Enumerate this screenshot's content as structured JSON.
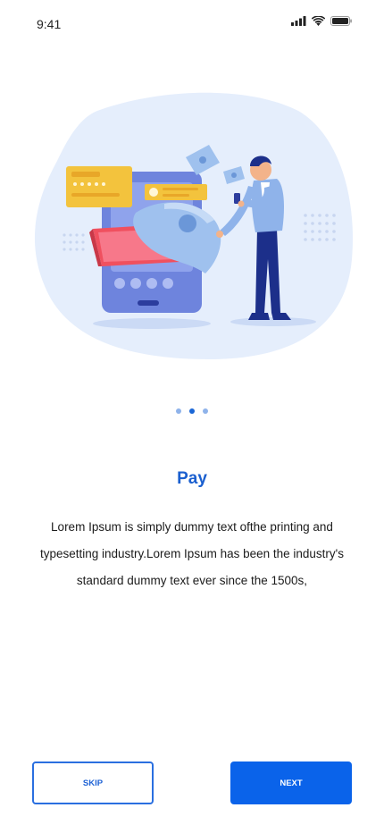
{
  "status_bar": {
    "time": "9:41",
    "icons": [
      "signal-icon",
      "wifi-icon",
      "battery-icon"
    ]
  },
  "onboarding": {
    "page_indicator": {
      "total": 3,
      "active_index": 1
    },
    "title": "Pay",
    "description": "Lorem Ipsum is simply dummy text ofthe printing and typesetting industry.Lorem Ipsum has been the industry's standard dummy text ever since the 1500s,"
  },
  "buttons": {
    "skip": "SKIP",
    "next": "NEXT"
  },
  "colors": {
    "accent": "#0a63ea",
    "title": "#1a5fcf",
    "illustration_bg": "#e5eefc"
  }
}
